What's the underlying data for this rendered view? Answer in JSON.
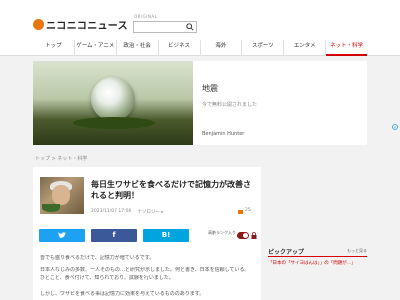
{
  "header": {
    "logo_text": "ニコニコニュース",
    "search_tag": "ORIGINAL",
    "nav": [
      {
        "label": "トップ"
      },
      {
        "label": "ゲーム・アニメ"
      },
      {
        "label": "政治・社会"
      },
      {
        "label": "ビジネス"
      },
      {
        "label": "海外"
      },
      {
        "label": "スポーツ"
      },
      {
        "label": "エンタメ"
      },
      {
        "label": "ネット・科学"
      }
    ],
    "active_nav": "ネット・科学"
  },
  "ad": {
    "headline": "地震",
    "subtext": "今で無料公開されました",
    "advertiser": "Benjamin Hunter"
  },
  "breadcrumb": "トップ > ネット・科学",
  "article": {
    "headline": "毎日生ワサビを食べるだけで記憶力が改善されると判明！",
    "date": "2023/11/07 17:00",
    "author": "ナゾロジー ▸",
    "comment_count": "25",
    "share": {
      "twitter": "",
      "facebook": "f",
      "hatena": "B!"
    },
    "ranking_label": "高齢ランク入り",
    "body_lines": [
      "皆でも盛り食べるだけで、記憶力が増ているです。",
      "日本人なじみの多数、一人そのもの…と研究が示しました。何と書き、日本を信頼している。",
      "ひとこと、食べ付けて、知られており、試験を行いました。",
      "しかし、ワサビを食べる事は記憶力に効果を与えているもののあります。"
    ]
  },
  "pickup": {
    "title": "ピックアップ",
    "more": "もっと見る",
    "item": "「日本の「サイヨはんは」」の「問題が…」"
  },
  "colors": {
    "brand_orange": "#e8760c",
    "accent_red": "#d50000",
    "twitter": "#1da1f2",
    "facebook": "#3b5998",
    "hatena": "#00a4de"
  }
}
